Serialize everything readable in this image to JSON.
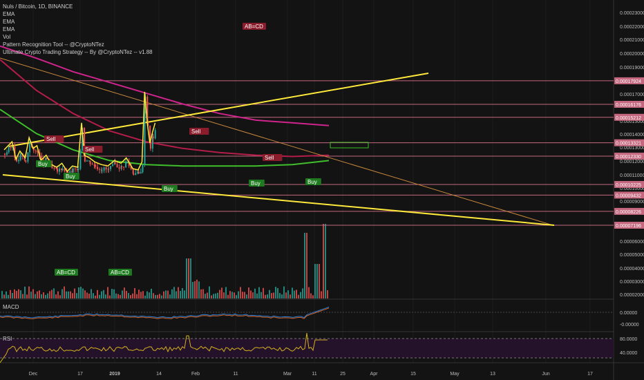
{
  "legend": {
    "symbol": "Nuls / Bitcoin, 1D, BINANCE",
    "items": [
      "EMA",
      "EMA",
      "EMA",
      "Vol",
      "Pattern Recognition Tool -- @CryptoNTez",
      "Ultimate Crypto Trading Strategy -- By @CryptoNTez -- v1.88"
    ]
  },
  "panes": {
    "macd": "MACD",
    "rsi": "RSI"
  },
  "colors": {
    "background": "#131313",
    "grid": "#1e1e1e",
    "yellow": "#ffe93b",
    "magenta": "#d0248d",
    "crimson": "#b41d4a",
    "green": "#3fbf2b",
    "orange": "#c8883c",
    "hline": "#c5687f",
    "up": "#26a69a",
    "down": "#ef5350",
    "label_red": "#8b1c2b",
    "label_green": "#1e7a1e",
    "macd": "#2a7fd4",
    "signal": "#d1632a",
    "rsi": "#d4b11c",
    "rsi_band": "#24122b"
  },
  "chart_data": {
    "type": "line",
    "title": "Nuls / Bitcoin, 1D, BINANCE",
    "x_axis_labels": [
      "Dec",
      "17",
      "2019",
      "14",
      "Feb",
      "11",
      "Mar",
      "11",
      "25",
      "Apr",
      "15",
      "May",
      "13",
      "Jun",
      "17"
    ],
    "y_axis_labels": [
      "0.00023000",
      "0.00022000",
      "0.00021000",
      "0.00020000",
      "0.00019000",
      "0.00017000",
      "0.00015000",
      "0.00014000",
      "0.00013000",
      "0.00012000",
      "0.00011000",
      "0.00010000",
      "0.00009000",
      "0.00006000",
      "0.00005000",
      "0.00004000",
      "0.00003000",
      "0.00002000"
    ],
    "price_levels": [
      "0.00017924",
      "0.00016176",
      "0.00015212",
      "0.00013321",
      "0.00012330",
      "0.00010225",
      "0.00009432",
      "0.00008226",
      "0.00007196"
    ],
    "ylim": [
      7.196e-05,
      0.00023
    ],
    "close_series": [
      [
        "2018-11-22",
        0.000125
      ],
      [
        "2018-11-25",
        0.000128
      ],
      [
        "2018-11-28",
        0.000131
      ],
      [
        "2018-12-01",
        0.000118
      ],
      [
        "2018-12-04",
        0.000124
      ],
      [
        "2018-12-08",
        0.000119
      ],
      [
        "2018-12-11",
        0.000134
      ],
      [
        "2018-12-14",
        0.000126
      ],
      [
        "2018-12-17",
        0.000128
      ],
      [
        "2018-12-20",
        0.000117
      ],
      [
        "2018-12-24",
        0.000121
      ],
      [
        "2018-12-28",
        0.000114
      ],
      [
        "2019-01-01",
        0.000112
      ],
      [
        "2019-01-05",
        0.000115
      ],
      [
        "2019-01-09",
        0.000109
      ],
      [
        "2019-01-13",
        0.000113
      ],
      [
        "2019-01-17",
        0.000112
      ],
      [
        "2019-01-20",
        0.000145
      ],
      [
        "2019-01-22",
        0.000121
      ],
      [
        "2019-01-26",
        0.000119
      ],
      [
        "2019-01-30",
        0.000116
      ],
      [
        "2019-02-04",
        0.000114
      ],
      [
        "2019-02-09",
        0.000113
      ],
      [
        "2019-02-14",
        0.000117
      ],
      [
        "2019-02-19",
        0.000115
      ],
      [
        "2019-02-23",
        0.000119
      ],
      [
        "2019-02-28",
        0.000111
      ],
      [
        "2019-03-04",
        0.00011
      ],
      [
        "2019-03-07",
        0.000116
      ],
      [
        "2019-03-09",
        0.000168
      ],
      [
        "2019-03-11",
        0.000145
      ],
      [
        "2019-03-13",
        0.00013
      ],
      [
        "2019-03-15",
        0.000138
      ],
      [
        "2019-03-17",
        0.000145
      ]
    ],
    "series": [
      {
        "name": "EMA",
        "values": [
          0.000205,
          0.000196,
          0.000186,
          0.000178,
          0.00017,
          0.000162,
          0.000155,
          0.00015,
          0.000148,
          0.000146
        ]
      },
      {
        "name": "EMA",
        "values": [
          0.000195,
          0.000172,
          0.000155,
          0.000142,
          0.000134,
          0.000129,
          0.000126,
          0.000124,
          0.000123,
          0.000124
        ]
      },
      {
        "name": "EMA",
        "values": [
          0.000158,
          0.00014,
          0.000128,
          0.00012,
          0.000117,
          0.000116,
          0.000116,
          0.000116,
          0.000117,
          0.00012
        ]
      }
    ],
    "patterns": {
      "sell": [
        "Sell",
        "Sell",
        "Sell",
        "Sell"
      ],
      "buy": [
        "Buy",
        "Buy",
        "Buy",
        "Buy",
        "Buy"
      ],
      "abcd": [
        "AB=CD",
        "AB=CD",
        "AB=CD"
      ]
    },
    "macd": {
      "yaxis": [
        "0.00000",
        "-0.00000"
      ]
    },
    "rsi": {
      "yaxis": [
        "80.0000",
        "40.0000"
      ],
      "ylim": [
        0,
        100
      ]
    }
  }
}
